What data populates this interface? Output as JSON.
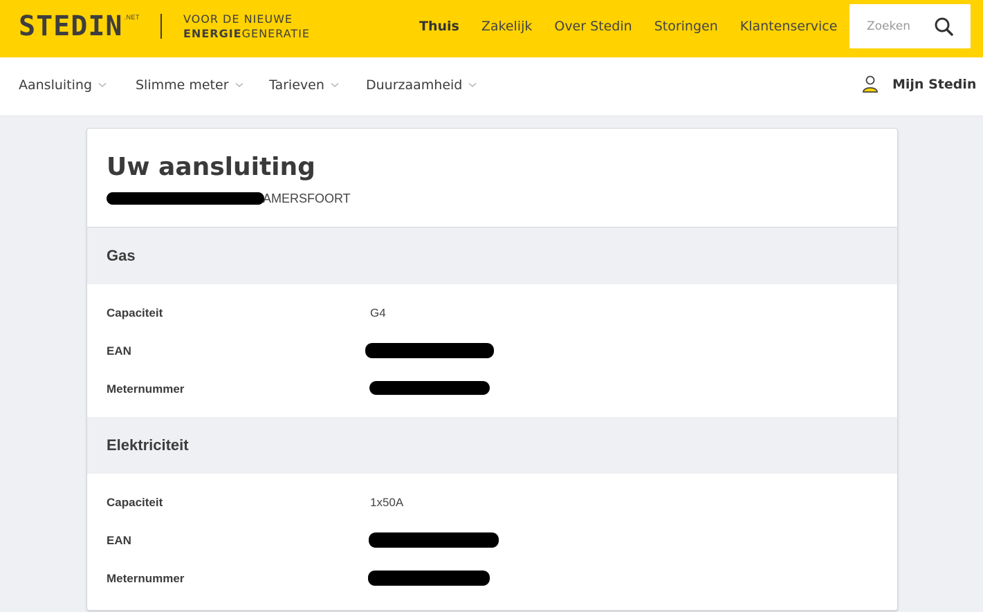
{
  "header": {
    "logo_text": "STEDIN",
    "logo_suffix": ".NET",
    "slogan_line1": "VOOR DE NIEUWE",
    "slogan_line2_bold": "ENERGIE",
    "slogan_line2_rest": "GENERATIE",
    "nav": [
      {
        "label": "Thuis",
        "active": true
      },
      {
        "label": "Zakelijk",
        "active": false
      },
      {
        "label": "Over Stedin",
        "active": false
      },
      {
        "label": "Storingen",
        "active": false
      },
      {
        "label": "Klantenservice",
        "active": false
      }
    ],
    "search": {
      "placeholder": "Zoeken",
      "icon": "search-icon"
    },
    "brand_color": "#ffd200"
  },
  "subnav": {
    "items": [
      {
        "label": "Aansluiting",
        "icon": "chevron-down-icon"
      },
      {
        "label": "Slimme meter",
        "icon": "chevron-down-icon"
      },
      {
        "label": "Tarieven",
        "icon": "chevron-down-icon"
      },
      {
        "label": "Duurzaamheid",
        "icon": "chevron-down-icon"
      }
    ],
    "account": {
      "label": "Mijn Stedin",
      "icon": "user-icon"
    }
  },
  "card": {
    "title": "Uw aansluiting",
    "address_city": "AMERSFOORT",
    "sections": [
      {
        "title": "Gas",
        "rows": [
          {
            "label": "Capaciteit",
            "value": "G4"
          },
          {
            "label": "EAN",
            "value": ""
          },
          {
            "label": "Meternummer",
            "value": ""
          }
        ]
      },
      {
        "title": "Elektriciteit",
        "rows": [
          {
            "label": "Capaciteit",
            "value": "1x50A"
          },
          {
            "label": "EAN",
            "value": ""
          },
          {
            "label": "Meternummer",
            "value": ""
          }
        ]
      }
    ]
  }
}
